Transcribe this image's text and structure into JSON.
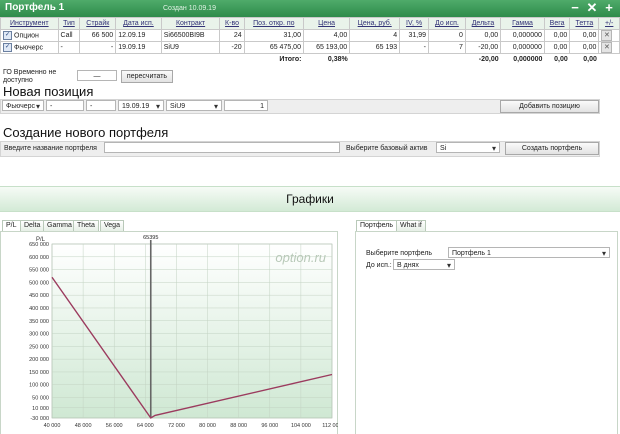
{
  "header": {
    "title": "Портфель 1",
    "created": "Создан 10.09.19"
  },
  "table": {
    "columns": [
      "Инструмент",
      "Тип",
      "Страйк",
      "Дата исп.",
      "Контракт",
      "К-во",
      "Поз. откр. по",
      "Цена",
      "Цена, руб.",
      "IV, %",
      "До исп.",
      "Дельта",
      "Гамма",
      "Вега",
      "Тетта",
      "+/-"
    ],
    "rows": [
      [
        "Опцион",
        "Call",
        "66 500",
        "12.09.19",
        "Si66500BI9B",
        "24",
        "31,00",
        "4,00",
        "4",
        "31,99",
        "0",
        "0,00",
        "0,000000",
        "0,00",
        "0,00"
      ],
      [
        "Фьючерс",
        "-",
        "-",
        "19.09.19",
        "SiU9",
        "-20",
        "65 475,00",
        "65 193,00",
        "65 193",
        "-",
        "7",
        "-20,00",
        "0,000000",
        "0,00",
        "0,00"
      ]
    ],
    "total_label": "Итого:",
    "totals": {
      "price": "0,38%",
      "delta": "-20,00",
      "gamma": "0,000000",
      "vega": "0,00",
      "theta": "0,00"
    }
  },
  "go": {
    "label": "ГО Временно не доступно",
    "value": "—",
    "recalc": "пересчитать"
  },
  "new_position": {
    "title": "Новая позиция",
    "instrument": "Фьючерс",
    "type": "-",
    "strike": "-",
    "date": "19.09.19",
    "contract": "SiU9",
    "qty": "1",
    "add_button": "Добавить позицию"
  },
  "create_portfolio": {
    "title": "Создание нового портфеля",
    "name_label": "Введите название портфеля",
    "base_label": "Выберите базовый актив",
    "base_value": "Si",
    "create_button": "Создать портфель"
  },
  "graphs": {
    "title": "Графики",
    "tabs": [
      "P/L",
      "Delta",
      "Gamma",
      "Theta",
      "Vega"
    ],
    "right_tabs": [
      "Портфель",
      "What if"
    ],
    "watermark": "option.ru",
    "select_portfolio_label": "Выберите портфель",
    "select_portfolio_value": "Портфель 1",
    "expiry_label": "До исп.:",
    "expiry_value": "В днях"
  },
  "chart_data": {
    "type": "line",
    "ylabel": "P/L",
    "marker_label": "65395",
    "marker_x": 65395,
    "xlim": [
      40000,
      112000
    ],
    "ylim": [
      -30000,
      650000
    ],
    "xticks": [
      "40 000",
      "48 000",
      "56 000",
      "64 000",
      "72 000",
      "80 000",
      "88 000",
      "96 000",
      "104 000",
      "112 000"
    ],
    "yticks": [
      "650 000",
      "600 000",
      "550 000",
      "500 000",
      "450 000",
      "400 000",
      "350 000",
      "300 000",
      "250 000",
      "200 000",
      "150 000",
      "100 000",
      "50 000",
      "10 000",
      "-30 000"
    ],
    "series": [
      {
        "x": [
          40000,
          65400,
          66500,
          112000
        ],
        "y": [
          520000,
          -30000,
          -20000,
          140000
        ]
      }
    ],
    "colors": {
      "line": "#9b3b5e",
      "fill": "#cfe8d3"
    }
  }
}
